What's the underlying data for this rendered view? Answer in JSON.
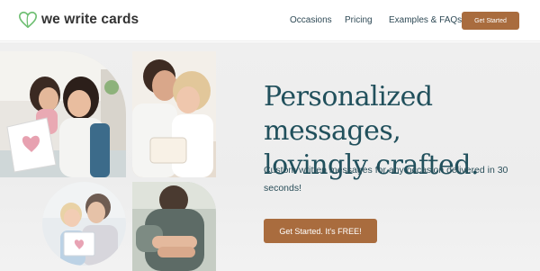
{
  "header": {
    "logo_text": "we write cards",
    "nav": {
      "occasions": "Occasions",
      "pricing": "Pricing",
      "examples": "Examples & FAQs"
    },
    "cta_label": "Get Started"
  },
  "hero": {
    "headline_line1": "Personalized messages,",
    "headline_line2": "lovingly crafted.",
    "subtext": "Custom written messages for any occasion delivered in 30 seconds!",
    "cta_label": "Get Started. It's FREE!"
  },
  "icons": {
    "logo": "heart-icon"
  },
  "colors": {
    "accent": "#a96c3e",
    "heading": "#21505c",
    "logo_heart": "#6fbf73"
  }
}
